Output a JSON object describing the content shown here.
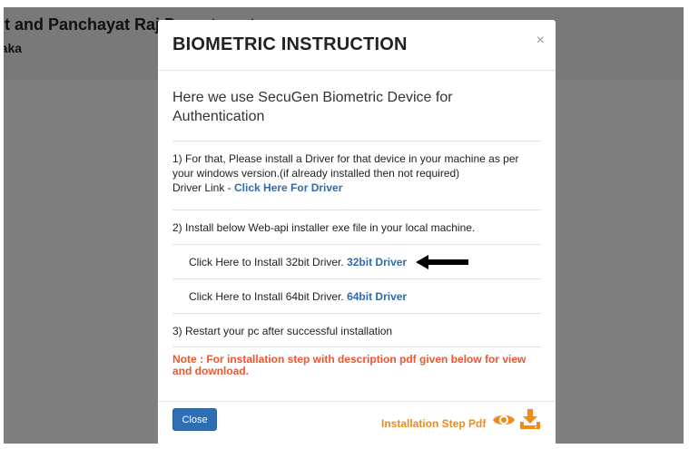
{
  "site": {
    "title": "nt and Panchayat Raj Department",
    "subtitle": "taka"
  },
  "modal": {
    "title": "BIOMETRIC INSTRUCTION",
    "close_symbol": "×",
    "intro": "Here we use SecuGen Biometric Device for Authentication",
    "step1_text": "1) For that, Please install a Driver for that device in your machine as per your windows version.(if already installed then not required)",
    "step1_link_prefix": "Driver Link - ",
    "step1_link": "Click Here For Driver",
    "step2_text": "2) Install below Web-api installer exe file in your local machine.",
    "install32_prefix": "Click Here to Install 32bit Driver. ",
    "install32_link": "32bit Driver",
    "install64_prefix": "Click Here to Install 64bit Driver. ",
    "install64_link": "64bit Driver",
    "step3_text": "3) Restart your pc after successful installation",
    "note": "Note : For installation step with description pdf given below for view and download.",
    "close_button": "Close",
    "pdf_label": "Installation Step Pdf"
  },
  "icons": {
    "eye": "eye-icon",
    "download": "download-icon",
    "arrow": "arrow-left-icon"
  },
  "colors": {
    "link": "#2f6bb3",
    "note": "#f2542d",
    "pdf": "#f08b17",
    "button": "#2e6eb5"
  }
}
